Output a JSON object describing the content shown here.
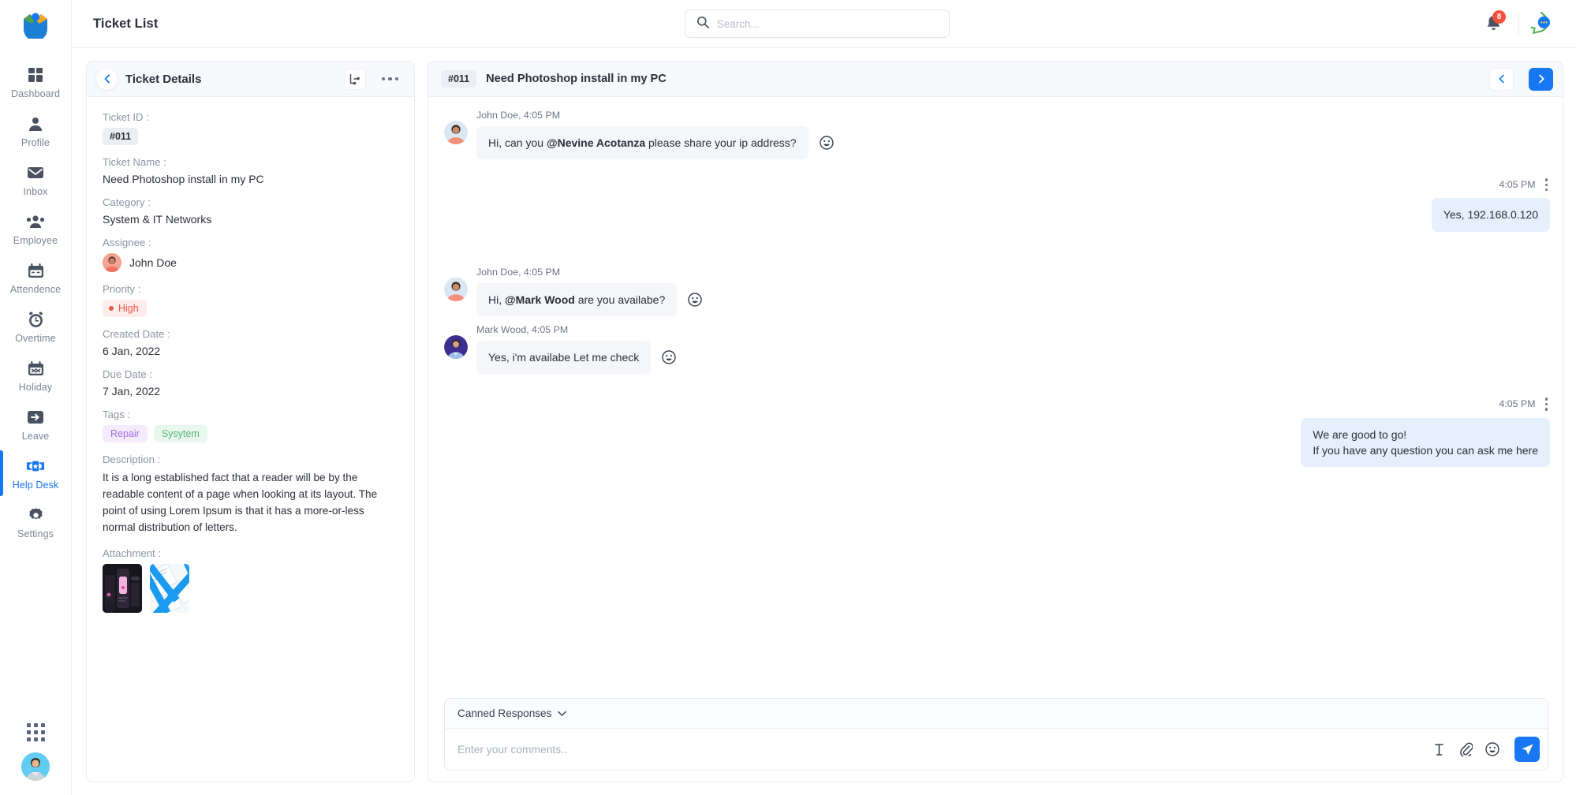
{
  "brand": {
    "accent": "#1877f2",
    "badge_red": "#f4503c"
  },
  "sidebar": {
    "logo_name": "app-logo",
    "items": [
      {
        "label": "Dashboard",
        "icon": "dashboard-icon"
      },
      {
        "label": "Profile",
        "icon": "user-icon"
      },
      {
        "label": "Inbox",
        "icon": "envelope-icon"
      },
      {
        "label": "Employee",
        "icon": "users-icon"
      },
      {
        "label": "Attendence",
        "icon": "calendar-icon"
      },
      {
        "label": "Overtime",
        "icon": "clock-icon"
      },
      {
        "label": "Holiday",
        "icon": "holiday-calendar-icon"
      },
      {
        "label": "Leave",
        "icon": "exit-arrow-icon"
      },
      {
        "label": "Help Desk",
        "icon": "ticket-icon"
      },
      {
        "label": "Settings",
        "icon": "gear-icon"
      }
    ],
    "active_label": "Help Desk"
  },
  "topbar": {
    "title": "Ticket List",
    "search_placeholder": "Search...",
    "search_value": "",
    "notification_count": "8"
  },
  "details": {
    "header_title": "Ticket Details",
    "fields": {
      "ticket_id_label": "Ticket ID :",
      "ticket_id_value": "#011",
      "ticket_name_label": "Ticket Name :",
      "ticket_name_value": "Need Photoshop install in my PC",
      "category_label": "Category :",
      "category_value": "System & IT Networks",
      "assignee_label": "Assignee :",
      "assignee_value": "John Doe",
      "priority_label": "Priority :",
      "priority_value": "High",
      "created_label": "Created Date :",
      "created_value": "6 Jan, 2022",
      "due_label": "Due Date :",
      "due_value": "7 Jan, 2022",
      "tags_label": "Tags :",
      "tags": [
        {
          "label": "Repair",
          "style": "purple"
        },
        {
          "label": "Sysytem",
          "style": "green"
        }
      ],
      "description_label": "Description :",
      "description_value": "It is a long established fact that a reader will be by the readable content of a page when looking at its layout. The point of using Lorem Ipsum is that it has a more-or-less normal distribution of letters.",
      "attachment_label": "Attachment :",
      "attachments": [
        {
          "name": "attachment-thumbnail-dark"
        },
        {
          "name": "attachment-thumbnail-blue"
        }
      ]
    }
  },
  "chat": {
    "header_id": "#011",
    "header_title": "Need Photoshop install in my PC",
    "messages": [
      {
        "direction": "in",
        "meta": "John Doe, 4:05 PM",
        "text_pre": "Hi, can you ",
        "mention": "@Nevine Acotanza",
        "text_post": " please share your ip address?"
      },
      {
        "direction": "out",
        "time": "4:05 PM",
        "text": "Yes, 192.168.0.120"
      },
      {
        "direction": "in",
        "meta": "John Doe, 4:05 PM",
        "text_pre": "Hi, ",
        "mention": "@Mark Wood",
        "text_post": " are you availabe?"
      },
      {
        "direction": "in",
        "meta": "Mark Wood, 4:05 PM",
        "text_pre": "Yes, i'm availabe Let me check",
        "mention": "",
        "text_post": ""
      },
      {
        "direction": "out",
        "time": "4:05 PM",
        "line1": "We are good to go!",
        "line2": "If you have any question you can ask me here"
      }
    ]
  },
  "composer": {
    "canned_label": "Canned Responses",
    "input_placeholder": "Enter your comments..",
    "input_value": "",
    "tools": [
      "text-format-icon",
      "attachment-clip-icon",
      "emoji-icon",
      "send-icon"
    ]
  }
}
